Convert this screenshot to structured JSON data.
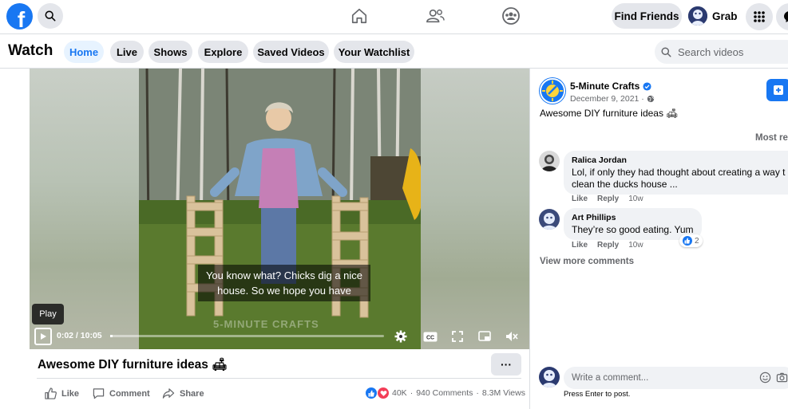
{
  "topbar": {
    "find_friends": "Find Friends",
    "user_name": "Grab"
  },
  "watchbar": {
    "title": "Watch",
    "tabs": [
      "Home",
      "Live",
      "Shows",
      "Explore",
      "Saved Videos",
      "Your Watchlist"
    ],
    "active_tab": "Home",
    "search_placeholder": "Search videos"
  },
  "video": {
    "caption": "You know what? Chicks dig a nice house. So we hope you have",
    "tooltip": "Play",
    "time_current": "0:02",
    "time_total": "10:05",
    "time_display": "0:02 / 10:05",
    "progress_fraction": 0.003,
    "watermark": "5-MINUTE CRAFTS",
    "title": "Awesome DIY furniture ideas 🛋",
    "more": "···"
  },
  "actions": {
    "like": "Like",
    "comment": "Comment",
    "share": "Share"
  },
  "stats": {
    "reactions": "40K",
    "comments": "940 Comments",
    "views": "8.3M Views",
    "separator": "·"
  },
  "post": {
    "page_name": "5-Minute Crafts",
    "date": "December 9, 2021 ·",
    "text": "Awesome DIY furniture ideas 🛋",
    "sort_label": "Most re"
  },
  "comments": [
    {
      "name": "Ralica Jordan",
      "text_line1": "Lol, if only they had thought about creating a way t",
      "text_line2": "clean the ducks house ...",
      "like": "Like",
      "reply": "Reply",
      "time": "10w"
    },
    {
      "name": "Art Phillips",
      "text_line1": "They’re so good eating. Yum",
      "like": "Like",
      "reply": "Reply",
      "time": "10w",
      "reactions": "2"
    }
  ],
  "view_more": "View more comments",
  "composer": {
    "placeholder": "Write a comment...",
    "hint": "Press Enter to post."
  },
  "colors": {
    "brand": "#1877f2",
    "background": "#ffffff",
    "secondary_text": "#65676b",
    "chip": "#e4e6eb"
  }
}
